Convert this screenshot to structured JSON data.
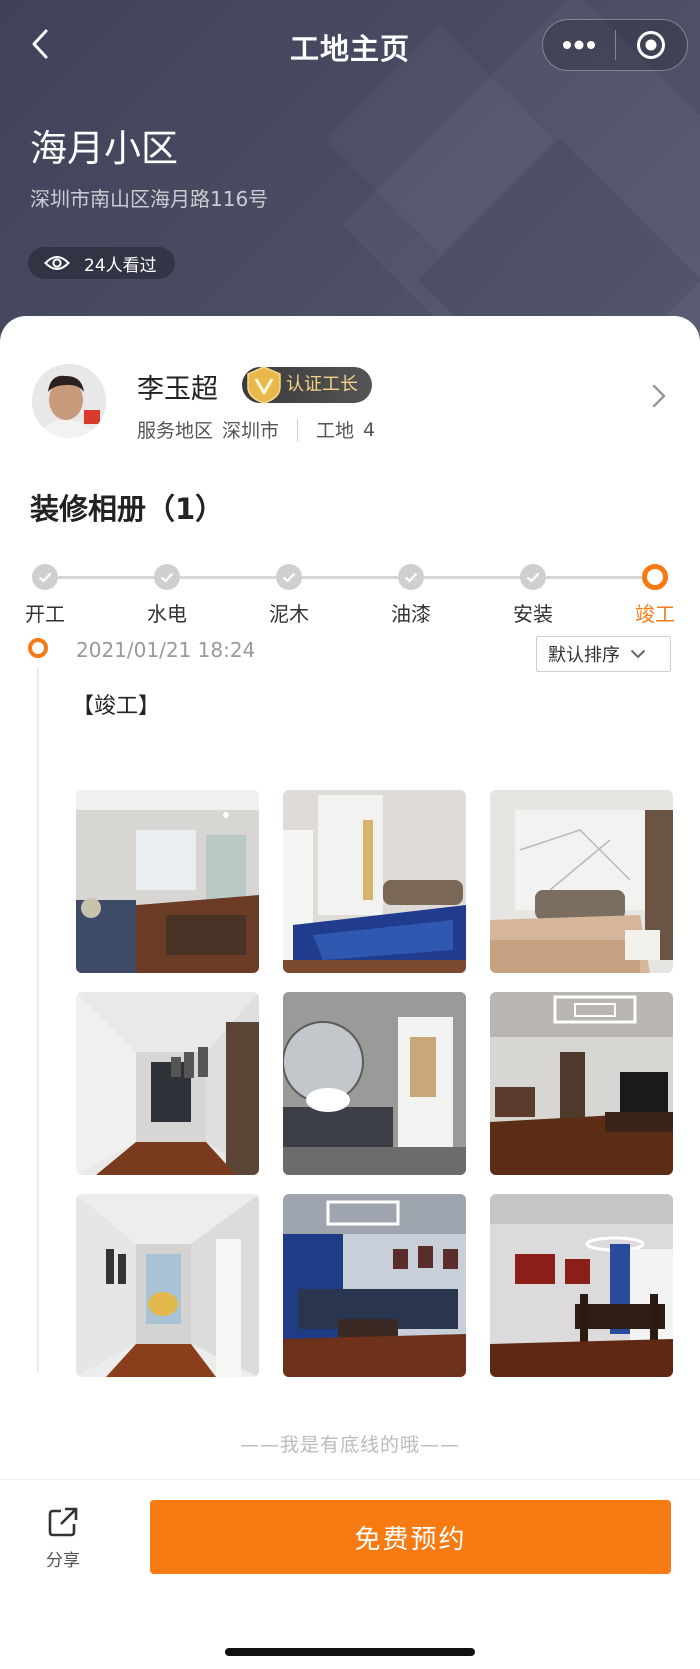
{
  "nav": {
    "title": "工地主页"
  },
  "site": {
    "name": "海月小区",
    "address": "深圳市南山区海月路116号",
    "views": "24人看过"
  },
  "worker": {
    "name": "李玉超",
    "badge": "认证工长",
    "service_area_label": "服务地区",
    "service_area": "深圳市",
    "sites_label": "工地",
    "sites_count": "4"
  },
  "album": {
    "title": "装修相册（1）"
  },
  "steps": [
    {
      "label": "开工",
      "done": true
    },
    {
      "label": "水电",
      "done": true
    },
    {
      "label": "泥木",
      "done": true
    },
    {
      "label": "油漆",
      "done": true
    },
    {
      "label": "安装",
      "done": true
    },
    {
      "label": "竣工",
      "active": true
    }
  ],
  "timeline": {
    "date": "2021/01/21 18:24",
    "sort_label": "默认排序",
    "phase": "【竣工】"
  },
  "photos": [
    "living-room",
    "bedroom-blue-bedding",
    "bedroom-marble-wall",
    "hallway-frames",
    "bathroom-vanity",
    "living-room-ceiling-lamp",
    "corridor-painting",
    "sofa-blue-curtains",
    "dining-room"
  ],
  "footer_note": "——我是有底线的哦——",
  "bottom": {
    "share_label": "分享",
    "book_label": "免费预约"
  },
  "colors": {
    "accent": "#f77a12",
    "header_bg": "#44475c"
  }
}
